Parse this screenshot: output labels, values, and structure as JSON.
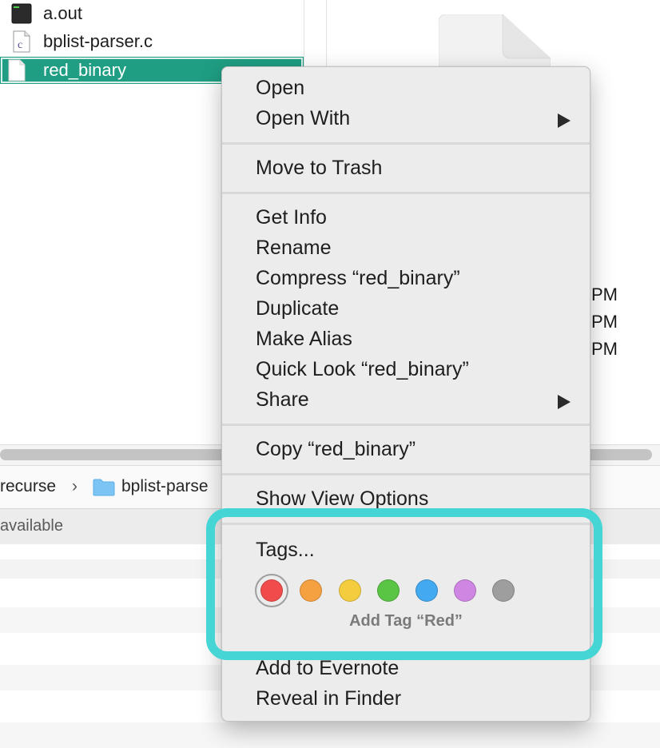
{
  "files": [
    {
      "name": "a.out",
      "icon": "terminal-exec-icon"
    },
    {
      "name": "bplist-parser.c",
      "icon": "c-source-file-icon"
    },
    {
      "name": "red_binary",
      "icon": "blank-document-icon",
      "selected": true
    }
  ],
  "dates": [
    "PM",
    "PM",
    "PM"
  ],
  "pathbar": {
    "segment_1": "recurse",
    "separator": "›",
    "segment_2": "bplist-parse"
  },
  "status": {
    "text": "available"
  },
  "context_menu": {
    "open": "Open",
    "open_with": "Open With",
    "move_to_trash": "Move to Trash",
    "get_info": "Get Info",
    "rename": "Rename",
    "compress": "Compress “red_binary”",
    "duplicate": "Duplicate",
    "make_alias": "Make Alias",
    "quick_look": "Quick Look “red_binary”",
    "share": "Share",
    "copy": "Copy “red_binary”",
    "show_view_options": "Show View Options",
    "tags": "Tags...",
    "tag_colors": [
      {
        "name": "Red",
        "color": "#f24b4b"
      },
      {
        "name": "Orange",
        "color": "#f5a142"
      },
      {
        "name": "Yellow",
        "color": "#f4cd3f"
      },
      {
        "name": "Green",
        "color": "#5ac445"
      },
      {
        "name": "Blue",
        "color": "#43a9f0"
      },
      {
        "name": "Purple",
        "color": "#cf86e3"
      },
      {
        "name": "Gray",
        "color": "#9e9e9e"
      }
    ],
    "tag_caption": "Add Tag “Red”",
    "add_to_evernote": "Add to Evernote",
    "reveal_in_finder": "Reveal in Finder"
  },
  "colors": {
    "selection": "#1f9e83",
    "highlight": "#45d5d5"
  }
}
